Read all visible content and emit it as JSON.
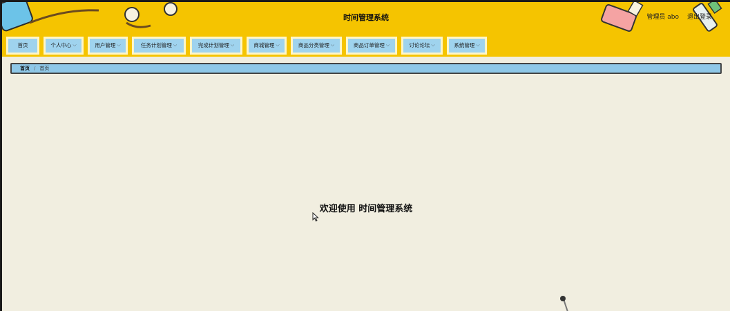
{
  "app": {
    "title": "时间管理系统"
  },
  "user": {
    "label": "管理员 abo",
    "logout": "退出登录"
  },
  "nav": {
    "items": [
      {
        "label": "首页",
        "dropdown": false
      },
      {
        "label": "个人中心",
        "dropdown": true
      },
      {
        "label": "用户管理",
        "dropdown": true
      },
      {
        "label": "任务计划管理",
        "dropdown": true
      },
      {
        "label": "完成计划管理",
        "dropdown": true
      },
      {
        "label": "商城管理",
        "dropdown": true
      },
      {
        "label": "商品分类管理",
        "dropdown": true
      },
      {
        "label": "商品订单管理",
        "dropdown": true
      },
      {
        "label": "讨论论坛",
        "dropdown": true
      },
      {
        "label": "系统管理",
        "dropdown": true
      }
    ]
  },
  "breadcrumb": {
    "home": "首页",
    "separator": "/",
    "current": "首页"
  },
  "main": {
    "welcome": "欢迎使用 时间管理系统"
  },
  "colors": {
    "header_bg": "#f5c400",
    "nav_item_bg": "#9fd3ee",
    "page_bg": "#f1eee0"
  }
}
